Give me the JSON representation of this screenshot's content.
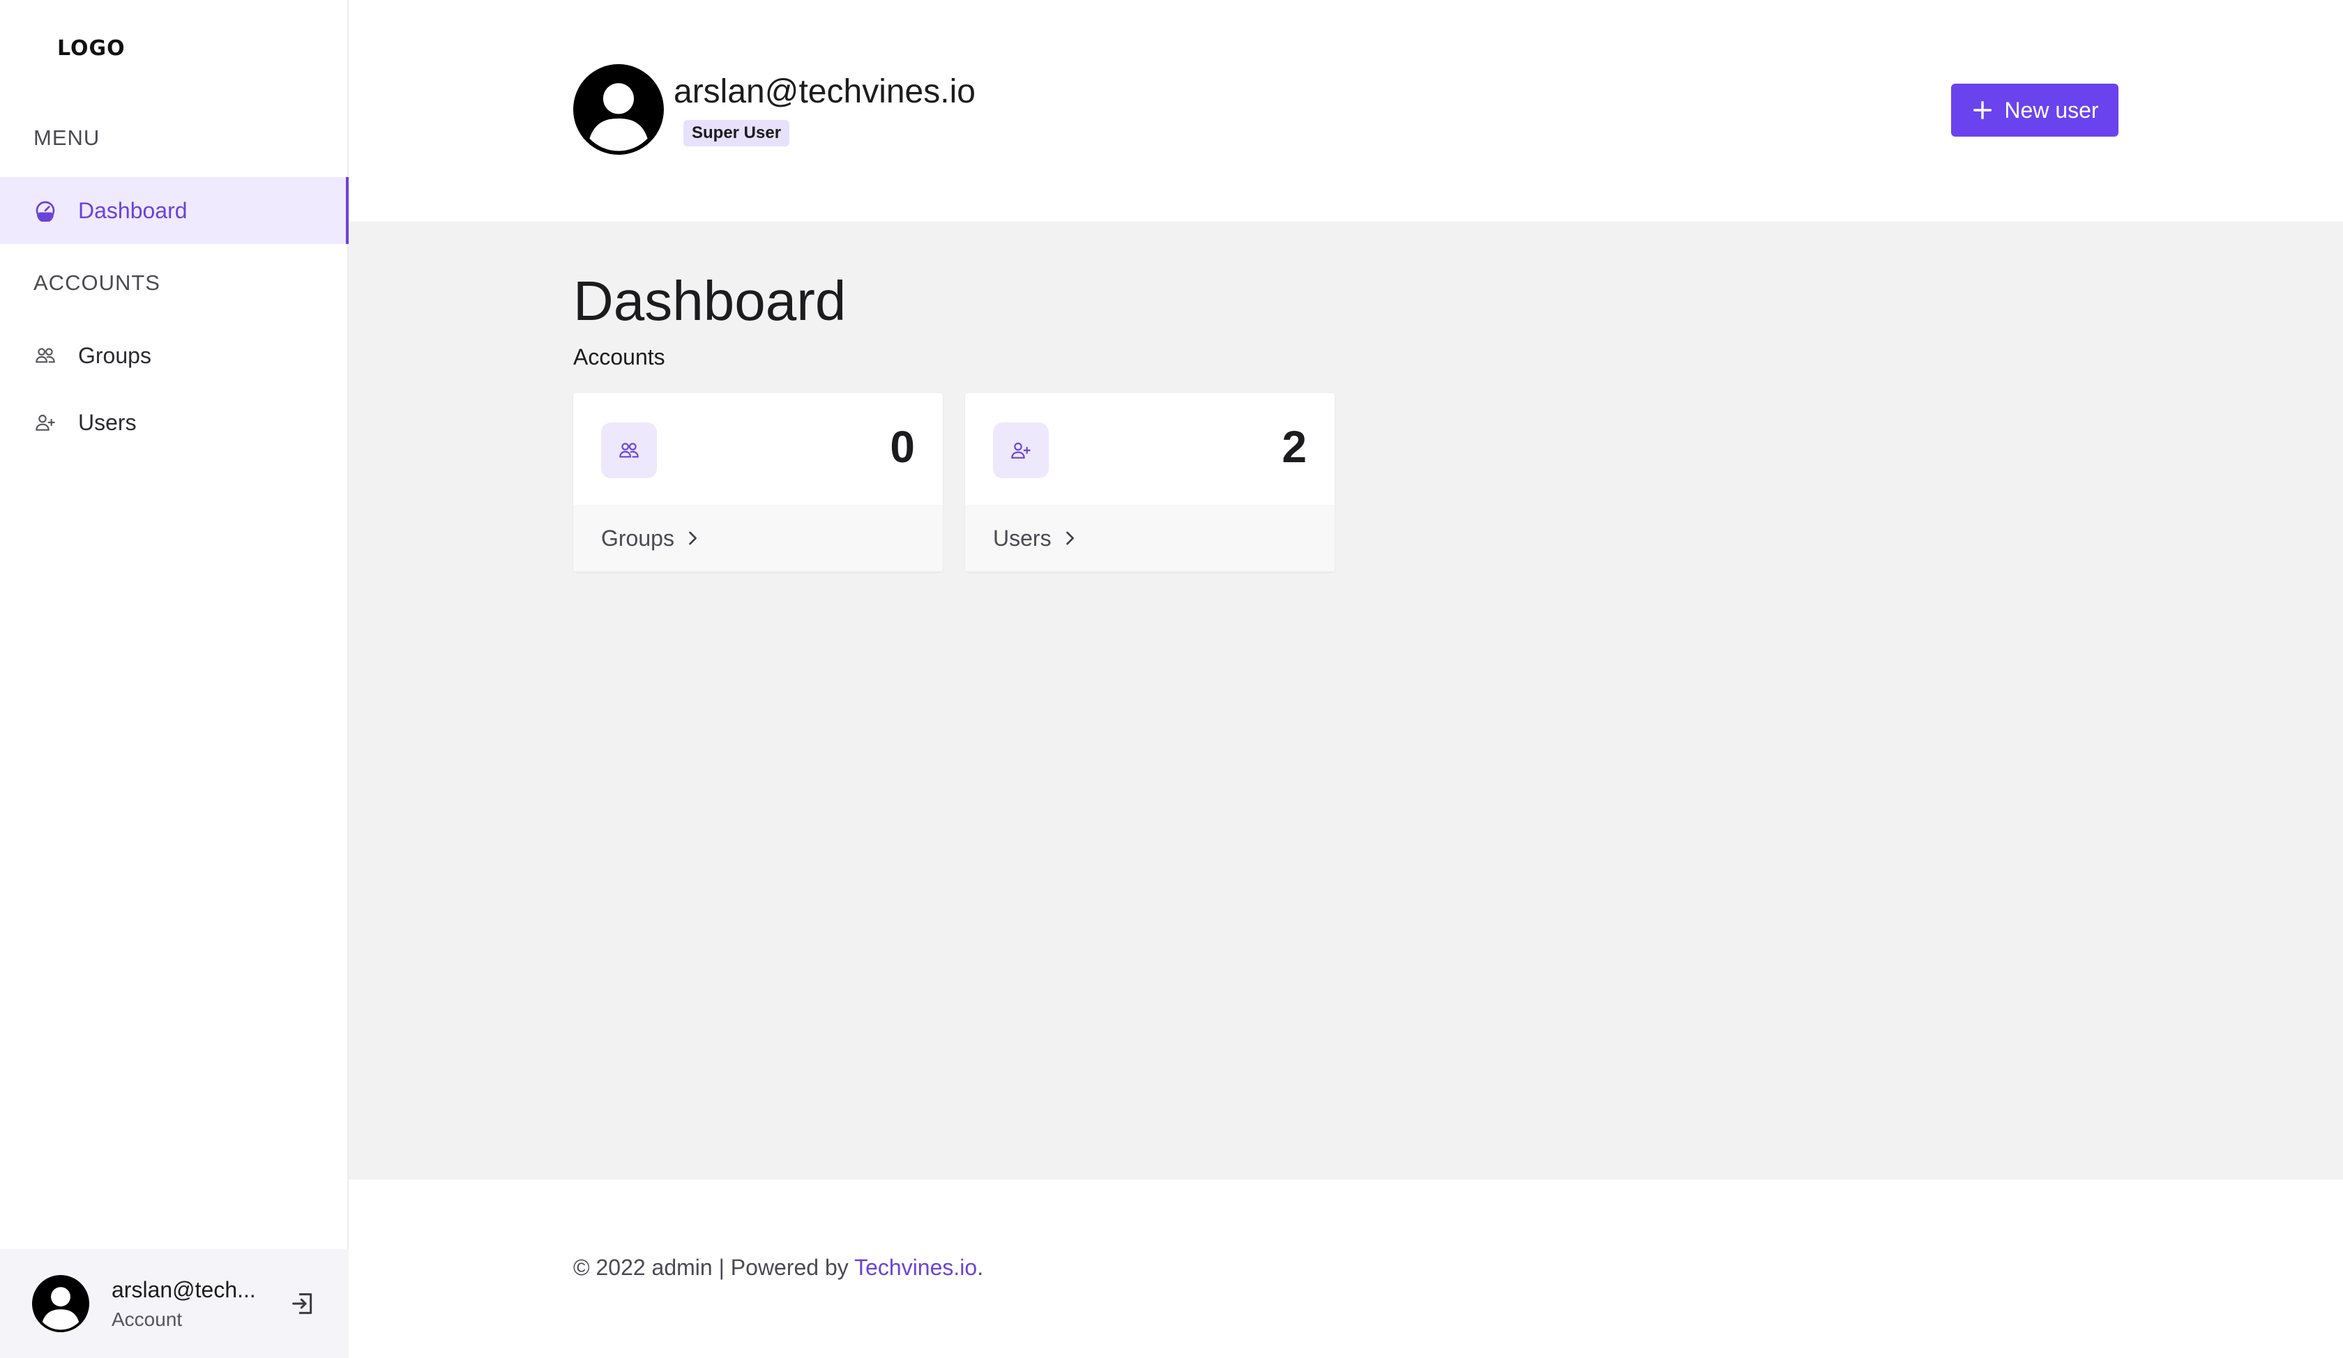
{
  "sidebar": {
    "logo_text": "LOGO",
    "menu_label": "MENU",
    "accounts_label": "ACCOUNTS",
    "items": [
      {
        "label": "Dashboard",
        "icon": "dashboard-gauge-icon",
        "active": true
      },
      {
        "label": "Groups",
        "icon": "groups-icon",
        "active": false
      },
      {
        "label": "Users",
        "icon": "user-plus-icon",
        "active": false
      }
    ],
    "account": {
      "email": "arslan@tech...",
      "subtitle": "Account",
      "avatar_icon": "user-avatar-icon",
      "logout_icon": "logout-icon"
    }
  },
  "header": {
    "email": "arslan@techvines.io",
    "role": "Super User",
    "new_user_label": "New user",
    "new_user_icon": "plus-icon"
  },
  "main": {
    "title": "Dashboard",
    "section": "Accounts",
    "cards": [
      {
        "label": "Groups",
        "count": "0",
        "icon": "groups-icon"
      },
      {
        "label": "Users",
        "count": "2",
        "icon": "user-plus-icon"
      }
    ]
  },
  "footer": {
    "prefix": "© 2022 admin | Powered by ",
    "link_text": "Techvines.io",
    "suffix": "."
  },
  "colors": {
    "accent": "#6a43ee",
    "accent_text": "#6a43d9",
    "active_bg": "#efeafd",
    "content_bg": "#f2f2f2"
  }
}
